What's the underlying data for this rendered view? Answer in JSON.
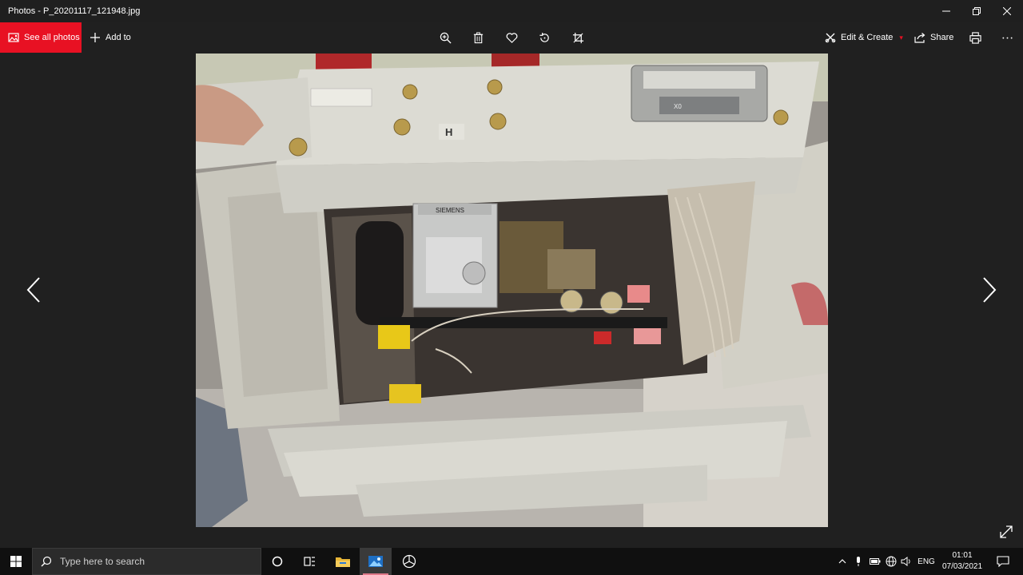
{
  "window": {
    "title": "Photos - P_20201117_121948.jpg",
    "controls": [
      "minimize-icon",
      "restore-icon",
      "close-icon"
    ]
  },
  "toolbar": {
    "see_all_label": "See all photos",
    "add_to_label": "Add to",
    "center_icons": [
      "zoom-in-icon",
      "delete-icon",
      "favorite-heart-icon",
      "rotate-icon",
      "crop-icon"
    ],
    "edit_create_label": "Edit & Create",
    "share_label": "Share",
    "right_icons": [
      "print-icon",
      "more-icon"
    ],
    "accent_color": "#e81123"
  },
  "photo": {
    "file": "P_20201117_121948.jpg",
    "nameplate_text": "SIEMENS",
    "label_h": "H",
    "label_x0": "X0"
  },
  "taskbar": {
    "search_placeholder": "Type here to search",
    "pinned_icons": [
      "cortana-icon",
      "task-view-icon",
      "file-explorer-icon",
      "photos-app-icon",
      "browser-icon"
    ],
    "tray_icons": [
      "chevron-up-icon",
      "microphone-icon",
      "battery-icon",
      "network-icon",
      "volume-icon"
    ],
    "language": "ENG",
    "time": "01:01",
    "date": "07/03/2021"
  }
}
